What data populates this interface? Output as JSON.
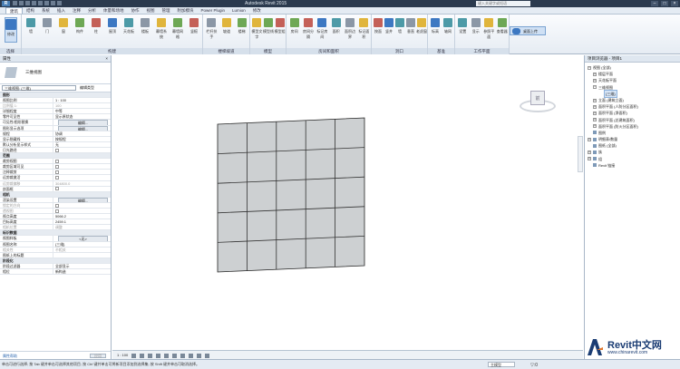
{
  "window": {
    "title": "Autodesk Revit 2015",
    "search_placeholder": "键入关键字或短语",
    "app_logo": "R",
    "controls": [
      "–",
      "□",
      "×"
    ]
  },
  "ribbon_tabs": [
    "建筑",
    "结构",
    "系统",
    "插入",
    "注释",
    "分析",
    "体量和场地",
    "协作",
    "视图",
    "管理",
    "附加模块",
    "Power Plugin",
    "Lumion",
    "修改"
  ],
  "ribbon_tabs_active": 0,
  "ribbon": {
    "groups": [
      {
        "title": "选择",
        "buttons": [
          "修改"
        ]
      },
      {
        "title": "构建",
        "buttons": [
          "墙",
          "门",
          "窗",
          "构件",
          "柱",
          "屋顶",
          "天花板",
          "楼板",
          "幕墙系统",
          "幕墙网格",
          "竖梃"
        ]
      },
      {
        "title": "楼梯坡道",
        "buttons": [
          "栏杆扶手",
          "坡道",
          "楼梯"
        ]
      },
      {
        "title": "模型",
        "buttons": [
          "模型文字",
          "模型线",
          "模型组"
        ]
      },
      {
        "title": "房间和面积",
        "buttons": [
          "房间",
          "房间分隔",
          "标记房间",
          "面积",
          "面积边界",
          "标记面积"
        ]
      },
      {
        "title": "洞口",
        "buttons": [
          "按面",
          "竖井",
          "墙",
          "垂直",
          "老虎窗"
        ]
      },
      {
        "title": "基准",
        "buttons": [
          "标高",
          "轴网"
        ]
      },
      {
        "title": "工作平面",
        "buttons": [
          "设置",
          "显示",
          "参照平面",
          "查看器"
        ]
      }
    ],
    "desktop_button": "桌面上传"
  },
  "properties": {
    "title": "属性",
    "close": "×",
    "type_label": "三维视图",
    "selector_value": "三维视图: {三维}",
    "edit_type": "编辑类型",
    "rows": [
      {
        "k": "图形",
        "v": "",
        "section": true
      },
      {
        "k": "视图比例",
        "v": "1 : 100"
      },
      {
        "k": "比例值 1:",
        "v": "100",
        "dim": true
      },
      {
        "k": "详细程度",
        "v": "中等"
      },
      {
        "k": "零件可见性",
        "v": "显示原状态"
      },
      {
        "k": "可见性/图形替换",
        "v": "编辑...",
        "button": true
      },
      {
        "k": "图形显示选项",
        "v": "编辑...",
        "button": true
      },
      {
        "k": "规程",
        "v": "协调"
      },
      {
        "k": "显示隐藏线",
        "v": "按规程"
      },
      {
        "k": "默认分析显示样式",
        "v": "无"
      },
      {
        "k": "日光路径",
        "v": "",
        "check": true
      },
      {
        "k": "范围",
        "v": "",
        "section": true
      },
      {
        "k": "裁剪视图",
        "v": "",
        "check": true
      },
      {
        "k": "裁剪区域可见",
        "v": "",
        "check": true
      },
      {
        "k": "注释裁剪",
        "v": "",
        "check": true
      },
      {
        "k": "远剪裁激活",
        "v": "",
        "check": true
      },
      {
        "k": "远剪裁偏移",
        "v": "304800.0",
        "dim": true
      },
      {
        "k": "剖面框",
        "v": "",
        "check": true
      },
      {
        "k": "相机",
        "v": "",
        "section": true
      },
      {
        "k": "渲染设置",
        "v": "编辑...",
        "button": true
      },
      {
        "k": "锁定的方向",
        "v": "",
        "dim": true,
        "check": true
      },
      {
        "k": "透视图",
        "v": "",
        "dim": true,
        "check": true
      },
      {
        "k": "视点高度",
        "v": "5066.2"
      },
      {
        "k": "目标高度",
        "v": "2459.1"
      },
      {
        "k": "相机位置",
        "v": "调整",
        "dim": true
      },
      {
        "k": "标识数据",
        "v": "",
        "section": true
      },
      {
        "k": "视图样板",
        "v": "<无>",
        "button": true
      },
      {
        "k": "视图名称",
        "v": "{三维}"
      },
      {
        "k": "相关性",
        "v": "不相关",
        "dim": true
      },
      {
        "k": "图纸上的标题",
        "v": ""
      },
      {
        "k": "阶段化",
        "v": "",
        "section": true
      },
      {
        "k": "阶段过滤器",
        "v": "全部显示"
      },
      {
        "k": "相位",
        "v": "新构造"
      }
    ],
    "help_link": "属性帮助",
    "apply": "应用"
  },
  "viewcube": {
    "face": "前"
  },
  "view_bar": {
    "scale": "1 : 100"
  },
  "project_browser": {
    "title": "项目浏览器 - 项目1",
    "rows": [
      {
        "level": 0,
        "exp": "−",
        "text": "视图 (全部)"
      },
      {
        "level": 1,
        "exp": "+",
        "text": "楼层平面"
      },
      {
        "level": 1,
        "exp": "+",
        "text": "天花板平面"
      },
      {
        "level": 1,
        "exp": "−",
        "text": "三维视图"
      },
      {
        "level": 2,
        "exp": "",
        "text": "{三维}",
        "selected": true
      },
      {
        "level": 1,
        "exp": "+",
        "text": "立面 (建筑立面)"
      },
      {
        "level": 1,
        "exp": "+",
        "text": "面积平面 (人防分区面积)"
      },
      {
        "level": 1,
        "exp": "+",
        "text": "面积平面 (净面积)"
      },
      {
        "level": 1,
        "exp": "+",
        "text": "面积平面 (总建筑面积)"
      },
      {
        "level": 1,
        "exp": "+",
        "text": "面积平面 (防火分区面积)"
      },
      {
        "level": 0,
        "exp": "",
        "text": "图例",
        "icon": true
      },
      {
        "level": 0,
        "exp": "+",
        "text": "明细表/数量",
        "icon": true
      },
      {
        "level": 0,
        "exp": "",
        "text": "图纸 (全部)",
        "icon": true
      },
      {
        "level": 0,
        "exp": "+",
        "text": "族",
        "icon": true
      },
      {
        "level": 0,
        "exp": "+",
        "text": "组",
        "icon": true
      },
      {
        "level": 0,
        "exp": "",
        "text": "Revit 链接",
        "icon": true
      }
    ]
  },
  "statusbar": {
    "text": "单击可进行选择; 按 Tab 键并单击可选择其他项目; 按 Ctrl 键并单击可将新项目添加到选择集; 按 Shift 键并单击可取消选择。",
    "model": "主模型",
    "filter": "▽:0"
  },
  "watermark": {
    "brand": "Revit中文网",
    "url": "www.chinarevit.com"
  },
  "colors": {
    "accent": "#3d78c2",
    "panel_bg": "#e4ebf3",
    "wall_fill": "#cdd0d2"
  }
}
